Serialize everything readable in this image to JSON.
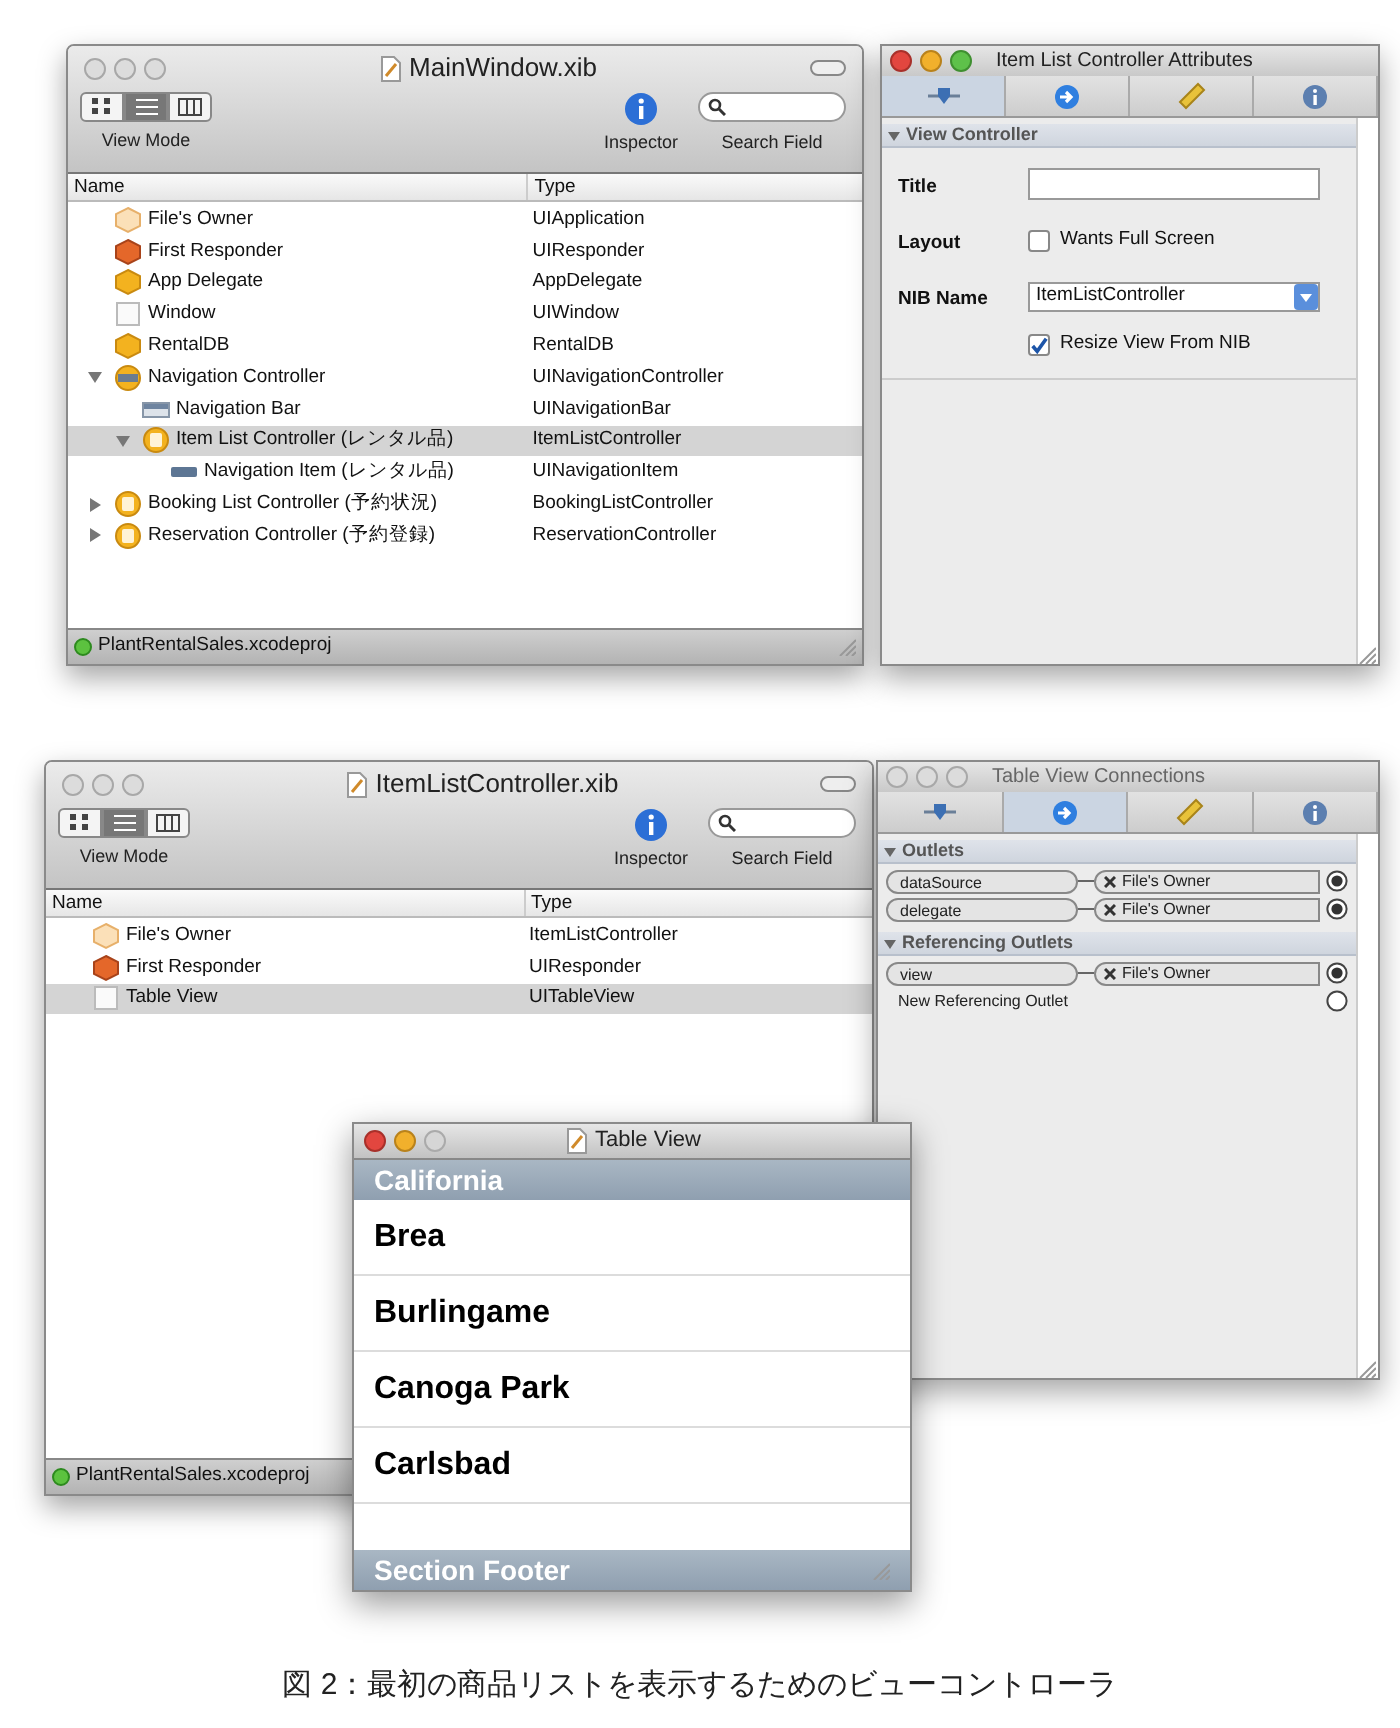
{
  "windows": [
    {
      "kind": "document",
      "title": "MainWindow.xib",
      "active": false,
      "view_modes": [
        {
          "kind": "icons",
          "selected": false
        },
        {
          "kind": "list",
          "selected": true
        },
        {
          "kind": "columns",
          "selected": false
        }
      ],
      "view_mode_label": "View Mode",
      "inspector_label": "Inspector",
      "search_label": "Search Field",
      "columns": [
        "Name",
        "Type"
      ],
      "rows": [
        {
          "kind": "owner",
          "name": "File's Owner",
          "type": "UIApplication",
          "selected": false
        },
        {
          "kind": "responder",
          "name": "First Responder",
          "type": "UIResponder",
          "selected": false
        },
        {
          "kind": "object",
          "name": "App Delegate",
          "type": "AppDelegate",
          "selected": false
        },
        {
          "kind": "window",
          "name": "Window",
          "type": "UIWindow",
          "selected": false
        },
        {
          "kind": "object",
          "name": "RentalDB",
          "type": "RentalDB",
          "selected": false
        },
        {
          "kind": "navcontroller",
          "name": "Navigation Controller",
          "type": "UINavigationController",
          "selected": false,
          "expanded": true,
          "children": [
            {
              "kind": "navbar",
              "name": "Navigation Bar",
              "type": "UINavigationBar",
              "selected": false
            },
            {
              "kind": "viewcontroller",
              "name": "Item List Controller (レンタル品)",
              "type": "ItemListController",
              "selected": true,
              "expanded": true,
              "children": [
                {
                  "kind": "navitem",
                  "name": "Navigation Item (レンタル品)",
                  "type": "UINavigationItem",
                  "selected": false
                }
              ]
            }
          ]
        },
        {
          "kind": "viewcontroller",
          "name": "Booking List Controller (予約状況)",
          "type": "BookingListController",
          "selected": false,
          "expanded": false
        },
        {
          "kind": "viewcontroller",
          "name": "Reservation Controller (予約登録)",
          "type": "ReservationController",
          "selected": false,
          "expanded": false
        }
      ],
      "status": "PlantRentalSales.xcodeproj"
    },
    {
      "kind": "inspector",
      "title": "Item List Controller Attributes",
      "active": true,
      "tabs": [
        {
          "kind": "view",
          "selected": true
        },
        {
          "kind": "connections",
          "selected": false
        },
        {
          "kind": "size",
          "selected": false
        },
        {
          "kind": "info",
          "selected": false
        }
      ],
      "sections": [
        {
          "kind": "form",
          "title": "View Controller",
          "expanded": true,
          "fields": [
            {
              "kind": "text",
              "label": "Title"
            },
            {
              "kind": "checkbox",
              "label": "Layout",
              "text": "Wants Full Screen",
              "checked": false
            },
            {
              "kind": "combo",
              "label": "NIB Name",
              "value": "ItemListController"
            },
            {
              "kind": "checkbox",
              "text": "Resize View From NIB",
              "checked": true
            }
          ]
        }
      ]
    },
    {
      "kind": "document",
      "title": "ItemListController.xib",
      "active": false,
      "view_modes": [
        {
          "kind": "icons",
          "selected": false
        },
        {
          "kind": "list",
          "selected": true
        },
        {
          "kind": "columns",
          "selected": false
        }
      ],
      "view_mode_label": "View Mode",
      "inspector_label": "Inspector",
      "search_label": "Search Field",
      "columns": [
        "Name",
        "Type"
      ],
      "rows": [
        {
          "kind": "owner",
          "name": "File's Owner",
          "type": "ItemListController",
          "selected": false
        },
        {
          "kind": "responder",
          "name": "First Responder",
          "type": "UIResponder",
          "selected": false
        },
        {
          "kind": "window",
          "name": "Table View",
          "type": "UITableView",
          "selected": true
        }
      ],
      "status": "PlantRentalSales.xcodeproj"
    },
    {
      "kind": "inspector",
      "title": "Table View Connections",
      "active": false,
      "tabs": [
        {
          "kind": "view",
          "selected": false
        },
        {
          "kind": "connections",
          "selected": true
        },
        {
          "kind": "size",
          "selected": false
        },
        {
          "kind": "info",
          "selected": false
        }
      ],
      "sections": [
        {
          "kind": "outlets",
          "title": "Outlets",
          "expanded": true,
          "items": [
            {
              "name": "dataSource",
              "target": "File's Owner",
              "connected": true
            },
            {
              "name": "delegate",
              "target": "File's Owner",
              "connected": true
            }
          ]
        },
        {
          "kind": "outlets",
          "title": "Referencing Outlets",
          "expanded": true,
          "items": [
            {
              "name": "view",
              "target": "File's Owner",
              "connected": true
            },
            {
              "name": "New Referencing Outlet",
              "connected": false
            }
          ]
        }
      ]
    },
    {
      "kind": "tableview",
      "title": "Table View",
      "active": true,
      "header": "California",
      "rows": [
        "Brea",
        "Burlingame",
        "Canoga Park",
        "Carlsbad"
      ],
      "footer": "Section Footer"
    }
  ],
  "caption": "図 2：最初の商品リストを表示するためのビューコントローラ"
}
